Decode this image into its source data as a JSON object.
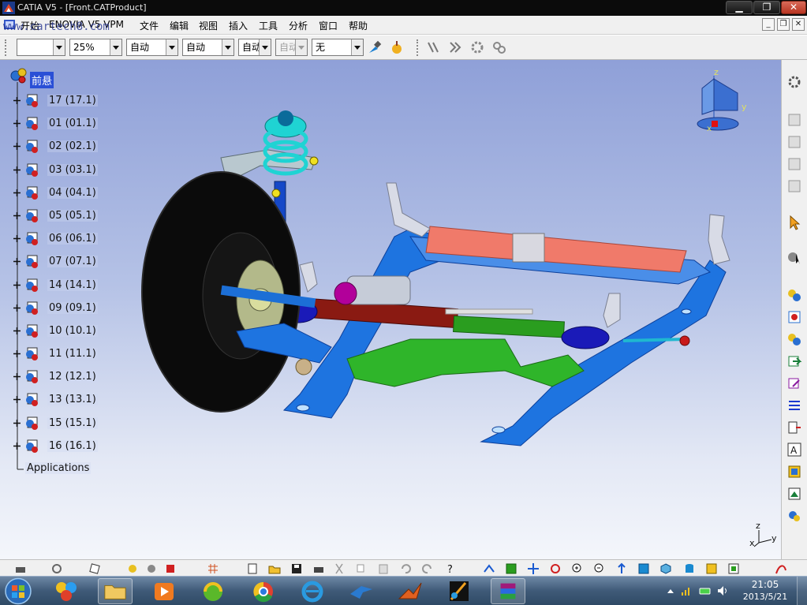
{
  "window": {
    "title": "CATIA V5 - [Front.CATProduct]",
    "watermark": "cartech8",
    "watermark_site": "www.cartech8.com"
  },
  "menu": {
    "items": [
      "开始",
      "ENOVIA V5 VPM",
      "文件",
      "编辑",
      "视图",
      "插入",
      "工具",
      "分析",
      "窗口",
      "帮助"
    ]
  },
  "toolbar": {
    "color_combo": "",
    "transparency_combo": "25%",
    "linetype_combo": "自动",
    "lineweight_combo": "自动",
    "point_combo": "自动",
    "layer_combo": "自动",
    "render_combo": "无"
  },
  "tree": {
    "root": "前悬",
    "nodes": [
      "17 (17.1)",
      "01 (01.1)",
      "02 (02.1)",
      "03 (03.1)",
      "04 (04.1)",
      "05 (05.1)",
      "06 (06.1)",
      "07 (07.1)",
      "14 (14.1)",
      "09 (09.1)",
      "10 (10.1)",
      "11 (11.1)",
      "12 (12.1)",
      "13 (13.1)",
      "15 (15.1)",
      "16 (16.1)"
    ],
    "applications": "Applications"
  },
  "compass": {
    "axis_x": "x",
    "axis_y": "y",
    "axis_z": "z"
  },
  "axis_triad": {
    "axis_x": "x",
    "axis_y": "y",
    "axis_z": "z"
  },
  "taskbar": {
    "time": "21:05",
    "date": "2013/5/21"
  },
  "colors": {
    "viewport_top": "#8fa0d8",
    "viewport_bottom": "#f4f6fb",
    "subframe_blue": "#1e74e0",
    "crossmember_red": "#f07a6a",
    "rack_green": "#2a9d1f",
    "coil_cyan": "#1fd3d3",
    "tree_selection": "#2a4fd6"
  }
}
